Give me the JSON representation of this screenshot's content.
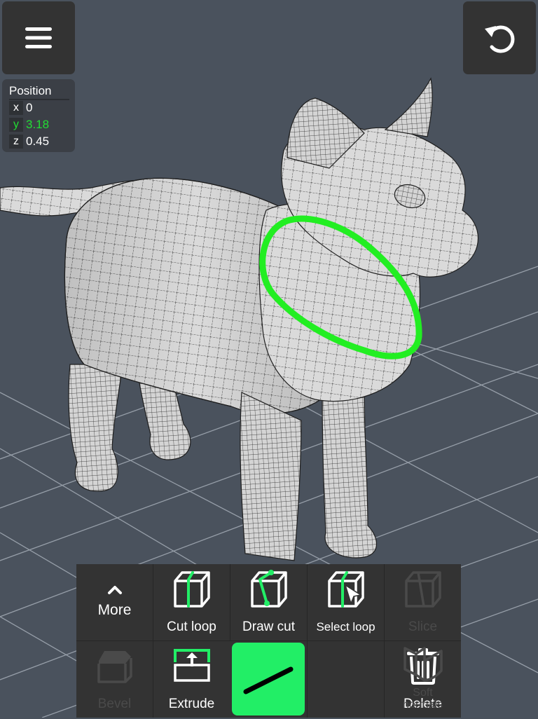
{
  "scene": {
    "background": "#4a525d",
    "grid_color": "#aab2bd",
    "mesh_fill": "#d9d9d9",
    "mesh_wire": "#1a1a1a",
    "selection_loop_color": "#22ee22",
    "object": "cat-mesh"
  },
  "header": {
    "menu_icon": "hamburger-menu-icon",
    "undo_icon": "undo-icon"
  },
  "position_panel": {
    "title": "Position",
    "rows": [
      {
        "axis": "x",
        "value": "0",
        "active": false
      },
      {
        "axis": "y",
        "value": "3.18",
        "active": true
      },
      {
        "axis": "z",
        "value": "0.45",
        "active": false
      }
    ],
    "active_color": "#22dd33"
  },
  "toolbar": {
    "accent": "#22ee66",
    "top_row": [
      {
        "id": "more",
        "label": "More",
        "icon": "chevron-up-icon",
        "enabled": true
      },
      {
        "id": "cut-loop",
        "label": "Cut loop",
        "icon": "cut-loop-icon",
        "enabled": true
      },
      {
        "id": "draw-cut",
        "label": "Draw cut",
        "icon": "draw-cut-icon",
        "enabled": true
      },
      {
        "id": "select-loop",
        "label": "Select loop",
        "icon": "select-loop-icon",
        "enabled": true
      },
      {
        "id": "slice",
        "label": "Slice",
        "icon": "slice-icon",
        "enabled": false
      }
    ],
    "bottom_row": [
      {
        "id": "bevel",
        "label": "Bevel",
        "icon": "bevel-icon",
        "enabled": false
      },
      {
        "id": "extrude",
        "label": "Extrude",
        "icon": "extrude-icon",
        "enabled": true
      },
      {
        "id": "line-tool",
        "label": "",
        "icon": "line-tool-icon",
        "enabled": true,
        "selected": true
      },
      {
        "id": "delete",
        "label": "Delete",
        "icon": "trash-icon",
        "enabled": true
      },
      {
        "id": "soft-normals",
        "label": "Soft normals",
        "icon": "soft-normals-icon",
        "enabled": false
      }
    ]
  }
}
